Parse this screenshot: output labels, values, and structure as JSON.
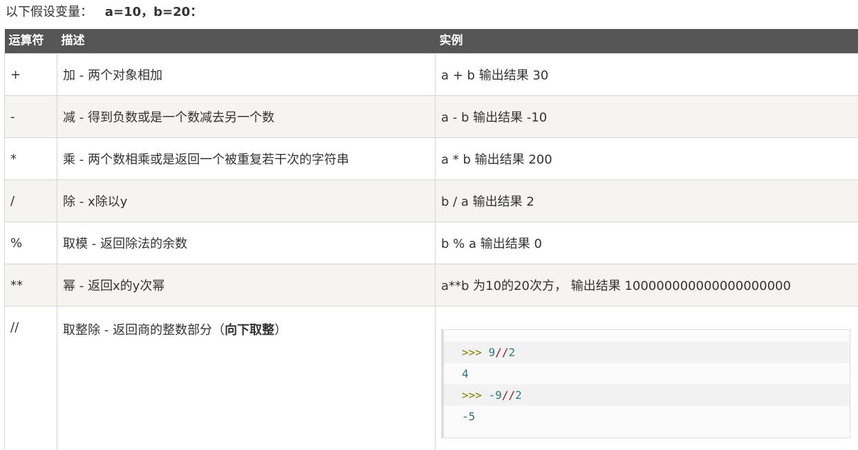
{
  "intro": {
    "text": "以下假设变量：",
    "vars": "a=10，b=20："
  },
  "table": {
    "headers": [
      "运算符",
      "描述",
      "实例"
    ],
    "rows": [
      {
        "op": "+",
        "desc": "加 - 两个对象相加",
        "example": "a + b 输出结果 30"
      },
      {
        "op": "-",
        "desc": "减 - 得到负数或是一个数减去另一个数",
        "example": "a - b 输出结果 -10"
      },
      {
        "op": "*",
        "desc": "乘 - 两个数相乘或是返回一个被重复若干次的字符串",
        "example": "a * b 输出结果 200"
      },
      {
        "op": "/",
        "desc": "除 - x除以y",
        "example": "b / a 输出结果 2"
      },
      {
        "op": "%",
        "desc": "取模 - 返回除法的余数",
        "example": "b % a 输出结果 0"
      },
      {
        "op": "**",
        "desc": "幂 - 返回x的y次幂",
        "example": "a**b 为10的20次方， 输出结果 100000000000000000000"
      },
      {
        "op": "//",
        "desc_pre": "取整除 - 返回商的整数部分（",
        "desc_bold": "向下取整",
        "desc_post": "）"
      }
    ]
  },
  "code": {
    "line1_prompt": ">>>",
    "line1_num1": "9",
    "line1_op": "//",
    "line1_num2": "2",
    "line2_out": "4",
    "line3_prompt": ">>>",
    "line3_num1": "-9",
    "line3_op": "//",
    "line3_num2": "2",
    "line4_out": "-5"
  }
}
